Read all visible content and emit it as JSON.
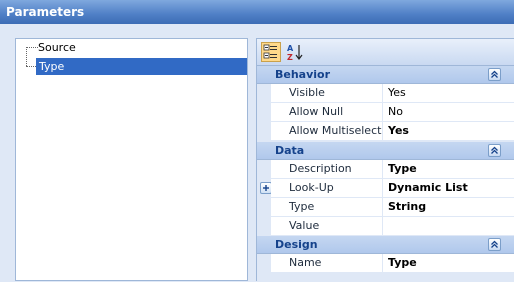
{
  "window": {
    "title": "Parameters"
  },
  "tree": {
    "items": [
      {
        "label": "Source",
        "selected": false
      },
      {
        "label": "Type",
        "selected": true
      }
    ]
  },
  "toolbar": {
    "categorized_icon": "categorized-icon",
    "alphabetical_icon": "sort-alphabetical-icon"
  },
  "grid": {
    "categories": [
      {
        "label": "Behavior",
        "rows": [
          {
            "name": "Visible",
            "value": "Yes",
            "bold": false
          },
          {
            "name": "Allow Null",
            "value": "No",
            "bold": false
          },
          {
            "name": "Allow Multiselect",
            "value": "Yes",
            "bold": true
          }
        ]
      },
      {
        "label": "Data",
        "rows": [
          {
            "name": "Description",
            "value": "Type",
            "bold": true
          },
          {
            "name": "Look-Up Settings",
            "value": "Dynamic List",
            "bold": true,
            "expandable": true
          },
          {
            "name": "Type",
            "value": "String",
            "bold": true
          },
          {
            "name": "Value",
            "value": "",
            "bold": false
          }
        ]
      },
      {
        "label": "Design",
        "rows": [
          {
            "name": "Name",
            "value": "Type",
            "bold": true
          }
        ]
      }
    ]
  },
  "colors": {
    "titlebar": "#4f7fc6",
    "selection": "#316ac5",
    "category_text": "#15428b",
    "panel_bg": "#dfe8f6"
  }
}
